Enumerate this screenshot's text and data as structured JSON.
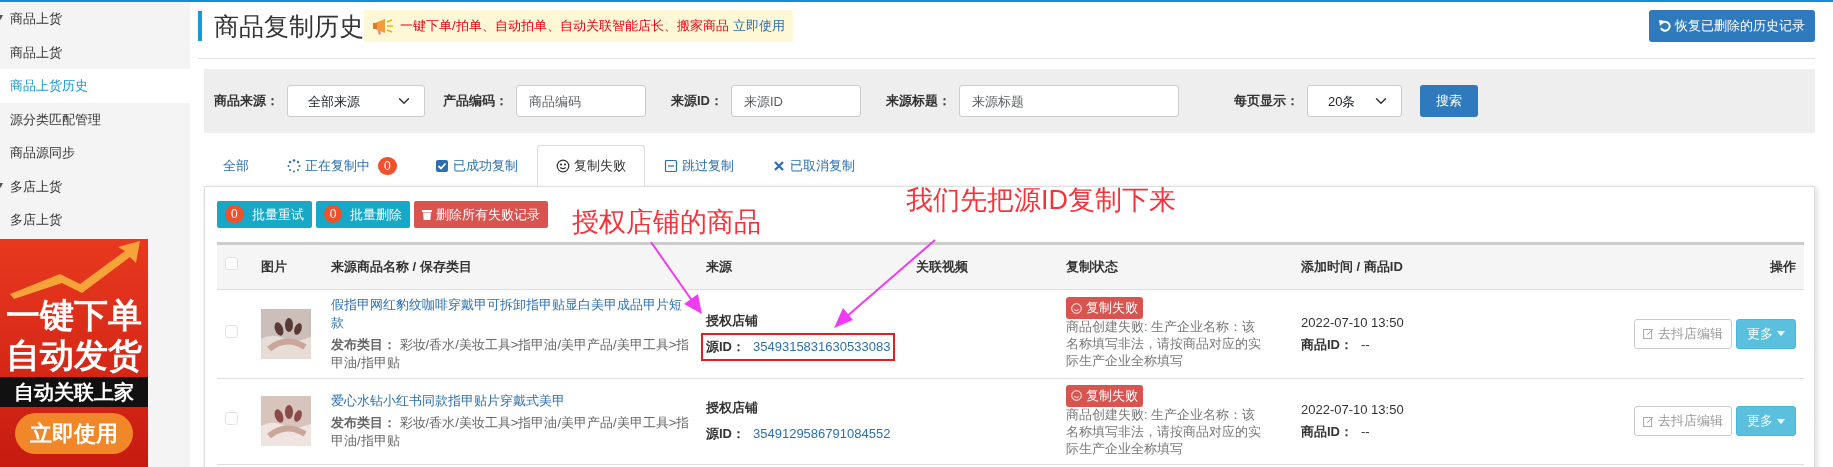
{
  "sidebar": {
    "items": [
      {
        "label": "商品上货",
        "expanded": true,
        "children": [
          {
            "label": "商品上货",
            "selected": false
          },
          {
            "label": "商品上货历史",
            "selected": true
          },
          {
            "label": "源分类匹配管理",
            "selected": false
          },
          {
            "label": "商品源同步",
            "selected": false
          }
        ]
      },
      {
        "label": "多店上货",
        "expanded": true,
        "children": [
          {
            "label": "多店上货",
            "selected": false
          }
        ]
      }
    ]
  },
  "ad_banner": {
    "lines": [
      "一键下单",
      "自动发货"
    ],
    "tag": "自动关联上家",
    "button": "立即使用"
  },
  "header": {
    "title": "商品复制历史",
    "promo": "一键下单/拍单、自动拍单、自动关联智能店长、搬家商品",
    "promo_link": "立即使用",
    "restore_button": "恢复已删除的历史记录"
  },
  "filters": [
    {
      "kind": "select",
      "label": "商品来源：",
      "value": "全部来源"
    },
    {
      "kind": "input",
      "label": "产品编码：",
      "placeholder": "商品编码"
    },
    {
      "kind": "input",
      "label": "来源ID：",
      "placeholder": "来源ID"
    },
    {
      "kind": "input",
      "label": "来源标题：",
      "placeholder": "来源标题"
    },
    {
      "kind": "select",
      "label": "每页显示：",
      "value": "20条"
    }
  ],
  "search_button": "搜索",
  "tabs": [
    {
      "kind": "plain",
      "label": "全部",
      "selected": false
    },
    {
      "kind": "spinner",
      "label": "正在复制中",
      "count": "0",
      "selected": false
    },
    {
      "kind": "check",
      "label": "已成功复制",
      "selected": false
    },
    {
      "kind": "smile",
      "label": "复制失败",
      "selected": true
    },
    {
      "kind": "minus",
      "label": "跳过复制",
      "selected": false
    },
    {
      "kind": "cross",
      "label": "已取消复制",
      "selected": false
    }
  ],
  "toolbar": [
    {
      "kind": "info",
      "count": "0",
      "label": "批量重试"
    },
    {
      "kind": "info",
      "count": "0",
      "label": "批量删除"
    },
    {
      "kind": "danger",
      "label": "删除所有失败记录"
    }
  ],
  "table": {
    "select_all": {
      "checked": false
    },
    "columns": [
      "图片",
      "来源商品名称 / 保存类目",
      "来源",
      "关联视频",
      "复制状态",
      "添加时间 / 商品ID",
      "操作"
    ],
    "rows": [
      {
        "checked": false,
        "title": "假指甲网红豹纹咖啡穿戴甲可拆卸指甲贴显白美甲成品甲片短款",
        "category_label": "发布类目：",
        "category": "彩妆/香水/美妆工具>指甲油/美甲产品/美甲工具>指甲油/指甲贴",
        "source": "授权店铺",
        "source_id_label": "源ID：",
        "source_id": "3549315831630533083",
        "highlighted": true,
        "status": "复制失败",
        "status_message": "商品创建失败: 生产企业名称：该名称填写非法，请按商品对应的实际生产企业全称填写",
        "time": "2022-07-10 13:50",
        "product_id_label": "商品ID：",
        "product_id": "--",
        "edit_button": "去抖店编辑",
        "more_button": "更多"
      },
      {
        "checked": false,
        "title": "爱心水钻小红书同款指甲贴片穿戴式美甲",
        "category_label": "发布类目：",
        "category": "彩妆/香水/美妆工具>指甲油/美甲产品/美甲工具>指甲油/指甲贴",
        "source": "授权店铺",
        "source_id_label": "源ID：",
        "source_id": "3549129586791084552",
        "highlighted": false,
        "status": "复制失败",
        "status_message": "商品创建失败: 生产企业名称：该名称填写非法，请按商品对应的实际生产企业全称填写",
        "time": "2022-07-10 13:50",
        "product_id_label": "商品ID：",
        "product_id": "--",
        "edit_button": "去抖店编辑",
        "more_button": "更多"
      }
    ]
  },
  "annotations": [
    {
      "text": "授权店铺的商品"
    },
    {
      "text": "我们先把源ID复制下来"
    }
  ]
}
